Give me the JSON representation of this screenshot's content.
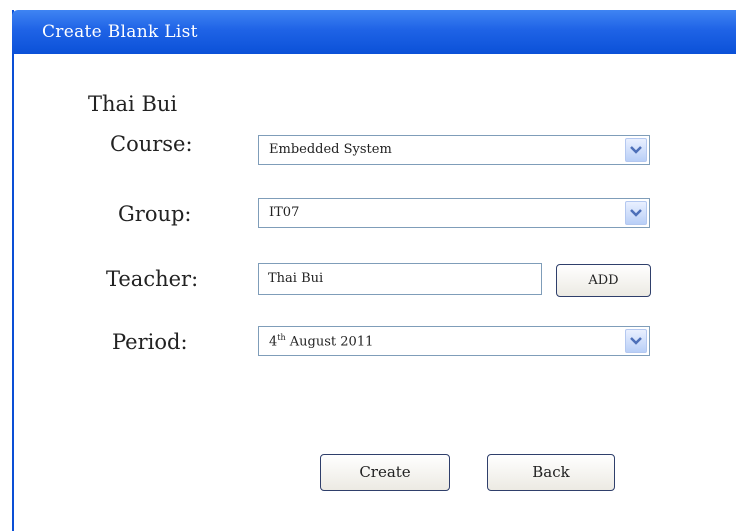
{
  "window": {
    "title": "Create Blank List"
  },
  "user_name": "Thai Bui",
  "form": {
    "course": {
      "label": "Course:",
      "value": "Embedded System"
    },
    "group": {
      "label": "Group:",
      "value": "IT07"
    },
    "teacher": {
      "label": "Teacher:",
      "value": "Thai Bui",
      "add_label": "ADD"
    },
    "period": {
      "label": "Period:",
      "value_day": "4",
      "value_suffix": "th",
      "value_rest": " August 2011"
    }
  },
  "buttons": {
    "create": "Create",
    "back": "Back"
  },
  "colors": {
    "titlebar": "#1f63e6",
    "border": "#0a4fd6"
  }
}
